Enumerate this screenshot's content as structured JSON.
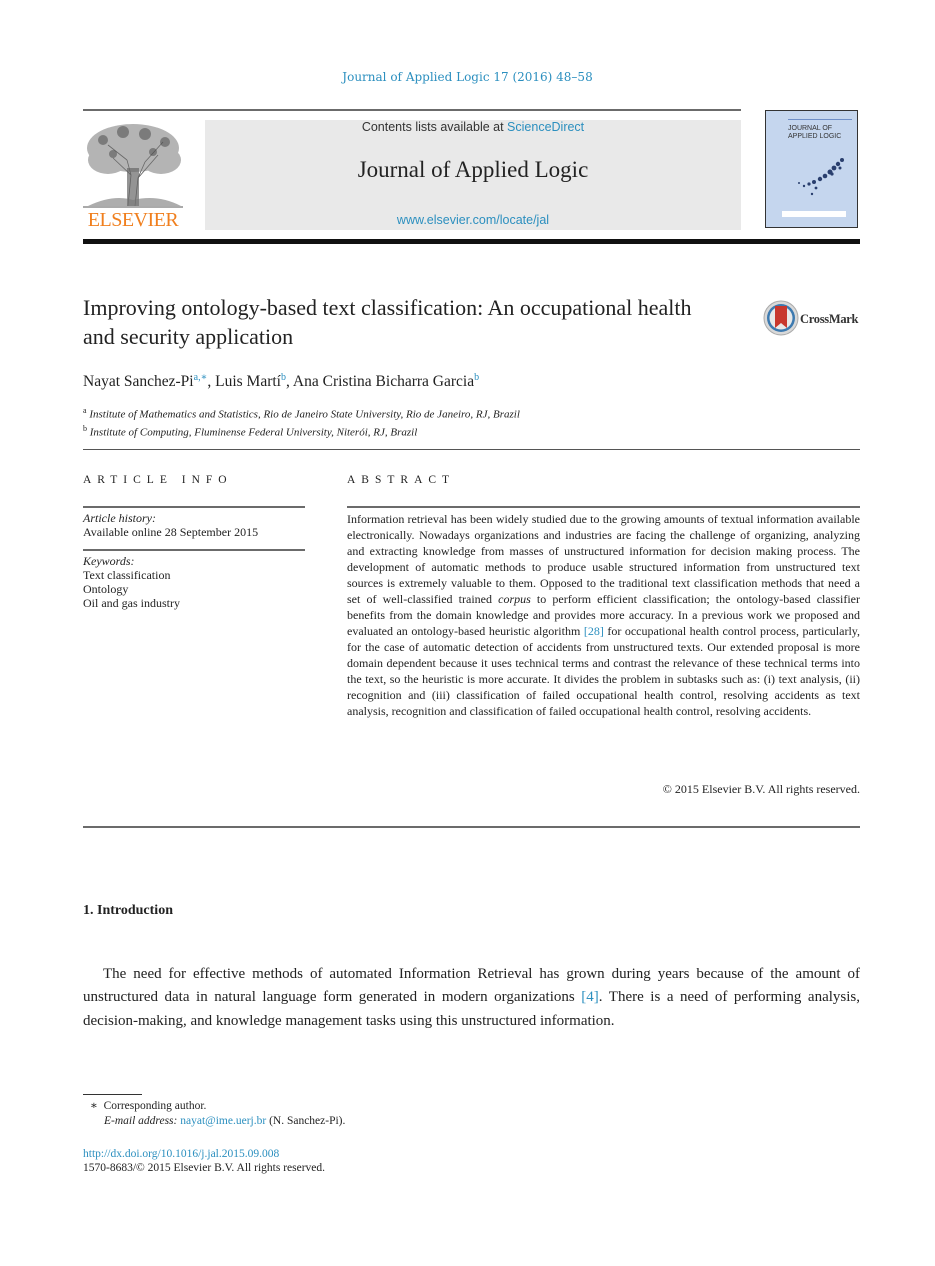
{
  "header": {
    "running_head": "Journal of Applied Logic 17 (2016) 48–58",
    "contents_prefix": "Contents lists available at ",
    "contents_link": "ScienceDirect",
    "journal_name": "Journal of Applied Logic",
    "journal_url": "www.elsevier.com/locate/jal",
    "publisher_logo_text": "ELSEVIER",
    "cover_title_line1": "JOURNAL OF",
    "cover_title_line2": "APPLIED LOGIC"
  },
  "article": {
    "title": "Improving ontology-based text classification: An occupational health and security application",
    "crossmark_label": "CrossMark",
    "authors": [
      {
        "name": "Nayat Sanchez-Pi",
        "sup": "a,∗"
      },
      {
        "name": "Luis Martí",
        "sup": "b"
      },
      {
        "name": "Ana Cristina Bicharra Garcia",
        "sup": "b"
      }
    ],
    "affiliations": [
      {
        "mark": "a",
        "text": "Institute of Mathematics and Statistics, Rio de Janeiro State University, Rio de Janeiro, RJ, Brazil"
      },
      {
        "mark": "b",
        "text": "Institute of Computing, Fluminense Federal University, Niterói, RJ, Brazil"
      }
    ]
  },
  "article_info": {
    "heading": "ARTICLE INFO",
    "history_label": "Article history:",
    "history_value": "Available online 28 September 2015",
    "keywords_label": "Keywords:",
    "keywords": [
      "Text classification",
      "Ontology",
      "Oil and gas industry"
    ]
  },
  "abstract": {
    "heading": "ABSTRACT",
    "part1": "Information retrieval has been widely studied due to the growing amounts of textual information available electronically. Nowadays organizations and industries are facing the challenge of organizing, analyzing and extracting knowledge from masses of unstructured information for decision making process. The development of automatic methods to produce usable structured information from unstructured text sources is extremely valuable to them. Opposed to the traditional text classification methods that need a set of well-classified trained ",
    "italic_word": "corpus",
    "part2": " to perform efficient classification; the ontology-based classifier benefits from the domain knowledge and provides more accuracy. In a previous work we proposed and evaluated an ontology-based heuristic algorithm ",
    "citation": "[28]",
    "part3": " for occupational health control process, particularly, for the case of automatic detection of accidents from unstructured texts. Our extended proposal is more domain dependent because it uses technical terms and contrast the relevance of these technical terms into the text, so the heuristic is more accurate. It divides the problem in subtasks such as: (i) text analysis, (ii) recognition and (iii) classification of failed occupational health control, resolving accidents as text analysis, recognition and classification of failed occupational health control, resolving accidents.",
    "copyright": "© 2015 Elsevier B.V. All rights reserved."
  },
  "introduction": {
    "heading": "1.  Introduction",
    "part1": "The need for effective methods of automated Information Retrieval has grown during years because of the amount of unstructured data in natural language form generated in modern organizations ",
    "citation": "[4]",
    "part2": ". There is a need of performing analysis, decision-making, and knowledge management tasks using this unstructured information."
  },
  "footnotes": {
    "star": "∗",
    "corresponding": "Corresponding author.",
    "email_label": "E-mail address:",
    "email": "nayat@ime.uerj.br",
    "email_suffix": " (N. Sanchez-Pi).",
    "doi": "http://dx.doi.org/10.1016/j.jal.2015.09.008",
    "issn": "1570-8683/© 2015 Elsevier B.V. All rights reserved."
  },
  "colors": {
    "link": "#2b8fbf",
    "elsevier_orange": "#f07f1e",
    "cover_blue": "#c5d6ee",
    "masthead_gray": "#e9e9e9"
  }
}
